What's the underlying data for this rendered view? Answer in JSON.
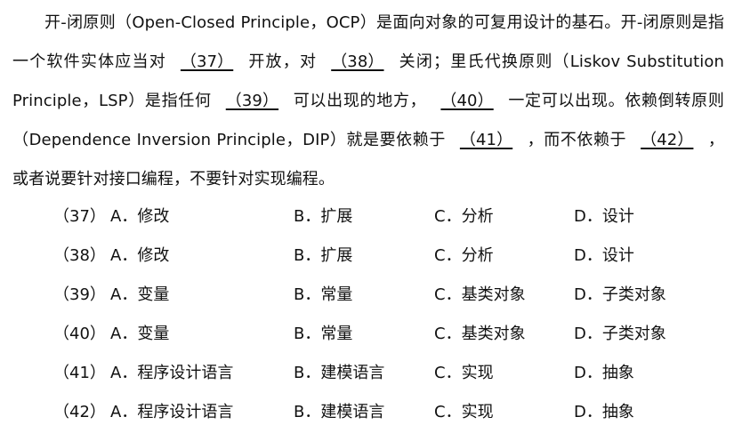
{
  "paragraph": {
    "t1": "开-闭原则（Open-Closed Principle，OCP）是面向对象的可复用设计的基石。开-闭原则是指一个软件实体应当对",
    "b37": "（37）",
    "t2": "开放，对",
    "b38": "（38）",
    "t3": "关闭；里氏代换原则（Liskov Substitution Principle，LSP）是指任何",
    "b39": "（39）",
    "t4": "可以出现的地方，",
    "b40": "（40）",
    "t5": "一定可以出现。依赖倒转原则（Dependence Inversion Principle，DIP）就是要依赖于",
    "b41": "（41）",
    "t6": "，而不依赖于",
    "b42": "（42）",
    "t7": "，或者说要针对接口编程，不要针对实现编程。"
  },
  "questions": [
    {
      "no": "（37）",
      "a": "A．修改",
      "b": "B．扩展",
      "c": "C．分析",
      "d": "D．设计"
    },
    {
      "no": "（38）",
      "a": "A．修改",
      "b": "B．扩展",
      "c": "C．分析",
      "d": "D．设计"
    },
    {
      "no": "（39）",
      "a": "A．变量",
      "b": "B．常量",
      "c": "C．基类对象",
      "d": "D．子类对象"
    },
    {
      "no": "（40）",
      "a": "A．变量",
      "b": "B．常量",
      "c": "C．基类对象",
      "d": "D．子类对象"
    },
    {
      "no": "（41）",
      "a": "A．程序设计语言",
      "b": "B．建模语言",
      "c": "C．实现",
      "d": "D．抽象"
    },
    {
      "no": "（42）",
      "a": "A．程序设计语言",
      "b": "B．建模语言",
      "c": "C．实现",
      "d": "D．抽象"
    }
  ]
}
